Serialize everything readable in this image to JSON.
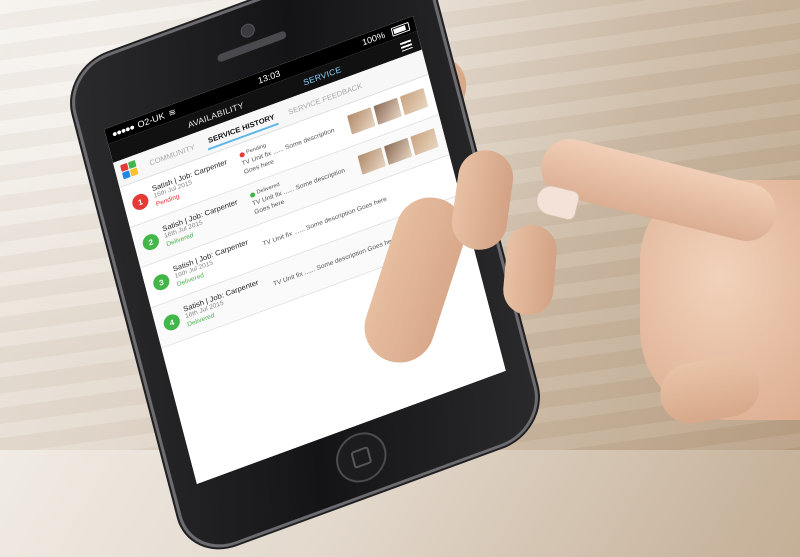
{
  "status_bar": {
    "carrier": "O2-UK",
    "time": "13:03",
    "battery": "100%"
  },
  "nav": {
    "items": [
      {
        "label": "AVAILABILITY",
        "active": false
      },
      {
        "label": "SERVICE",
        "active": true
      }
    ]
  },
  "subnav": {
    "tabs": [
      {
        "label": "COMMUNITY",
        "state": "muted"
      },
      {
        "label": "SERVICE HISTORY",
        "state": "active"
      },
      {
        "label": "SERVICE FEEDBACK",
        "state": "muted"
      }
    ]
  },
  "colors": {
    "pending": "#e53935",
    "delivered": "#43b649",
    "accent": "#5bb5e8",
    "logo": [
      "#e53935",
      "#43b649",
      "#1e88e5",
      "#fbc02d"
    ]
  },
  "service_list": [
    {
      "number": "1",
      "title": "Satish | Job: Carpenter",
      "date": "16th Jul 2015",
      "status": "Pending",
      "status_color": "#e53935",
      "badge": "Pending",
      "badge_color": "#e53935",
      "description": "TV Unit fix ...... Some description Goes here",
      "has_images": true
    },
    {
      "number": "2",
      "title": "Satish | Job: Carpenter",
      "date": "16th Jul 2015",
      "status": "Delivered",
      "status_color": "#43b649",
      "badge": "Delivered",
      "badge_color": "#43b649",
      "description": "TV Unit fix ...... Some description Goes here",
      "has_images": true
    },
    {
      "number": "3",
      "title": "Satish | Job: Carpenter",
      "date": "16th Jul 2015",
      "status": "Delivered",
      "status_color": "#43b649",
      "badge": "",
      "badge_color": "#43b649",
      "description": "TV Unit fix ...... Some description Goes here",
      "has_images": false
    },
    {
      "number": "4",
      "title": "Satish | Job: Carpenter",
      "date": "16th Jul 2015",
      "status": "Delivered",
      "status_color": "#43b649",
      "badge": "",
      "badge_color": "#43b649",
      "description": "TV Unit fix ...... Some description Goes here",
      "has_images": false
    }
  ]
}
